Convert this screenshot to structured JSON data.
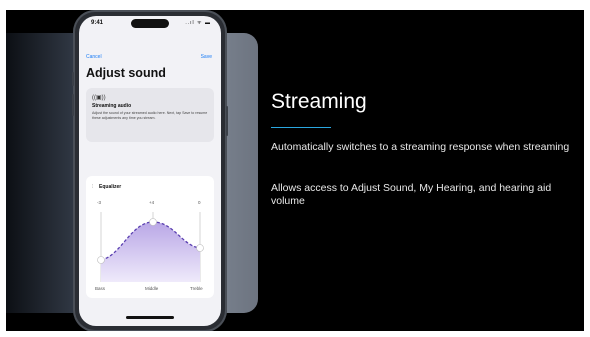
{
  "phone": {
    "status_time": "9:41",
    "status_icons": "..ıl ᯤ ▬",
    "nav": {
      "cancel": "Cancel",
      "save": "Save"
    },
    "title": "Adjust sound",
    "streaming_card": {
      "icon": "streaming-audio-icon",
      "icon_glyph": "((▣))",
      "heading": "Streaming audio",
      "description": "Adjust the sound of your streamed audio here. Next, tap Save to resume these adjustments any time you stream."
    },
    "equalizer": {
      "heading": "Equalizer",
      "icon_glyph": "⫶",
      "values": [
        "-3",
        "+4",
        "0"
      ],
      "bands": [
        "Bass",
        "Middle",
        "Treble"
      ],
      "levels": [
        -3,
        4,
        0
      ]
    }
  },
  "slide": {
    "heading": "Streaming",
    "accent_color": "#2aa7e0",
    "bullet1": "Automatically switches to a streaming response when streaming",
    "bullet2": "Allows access to Adjust Sound, My Hearing, and hearing aid volume"
  }
}
